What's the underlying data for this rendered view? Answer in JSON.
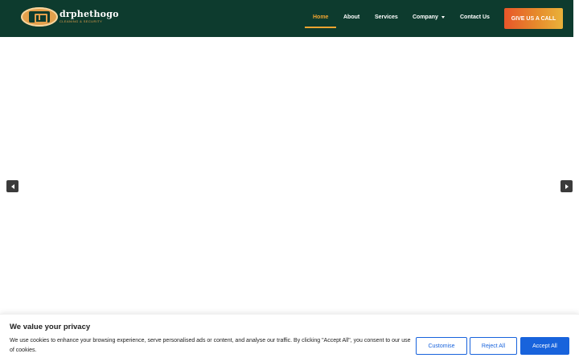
{
  "header": {
    "logo": {
      "name": "drphethogo",
      "tagline": "CLEANING & SECURITY"
    },
    "nav": [
      {
        "label": "Home",
        "active": true
      },
      {
        "label": "About"
      },
      {
        "label": "Services"
      },
      {
        "label": "Company",
        "has_dropdown": true
      },
      {
        "label": "Contact Us"
      }
    ],
    "cta_label": "GIVE US A CALL"
  },
  "slider": {
    "prev_icon": "chevron-left-icon",
    "next_icon": "chevron-right-icon"
  },
  "cookie_banner": {
    "title": "We value your privacy",
    "text": "We use cookies to enhance your browsing experience, serve personalised ads or content, and analyse our traffic. By clicking \"Accept All\", you consent to our use of cookies.",
    "customise_label": "Customise",
    "reject_label": "Reject All",
    "accept_label": "Accept All"
  },
  "colors": {
    "header_bg": "#0d3b2e",
    "nav_active": "#f0a431",
    "cookie_button": "#1863dc"
  }
}
